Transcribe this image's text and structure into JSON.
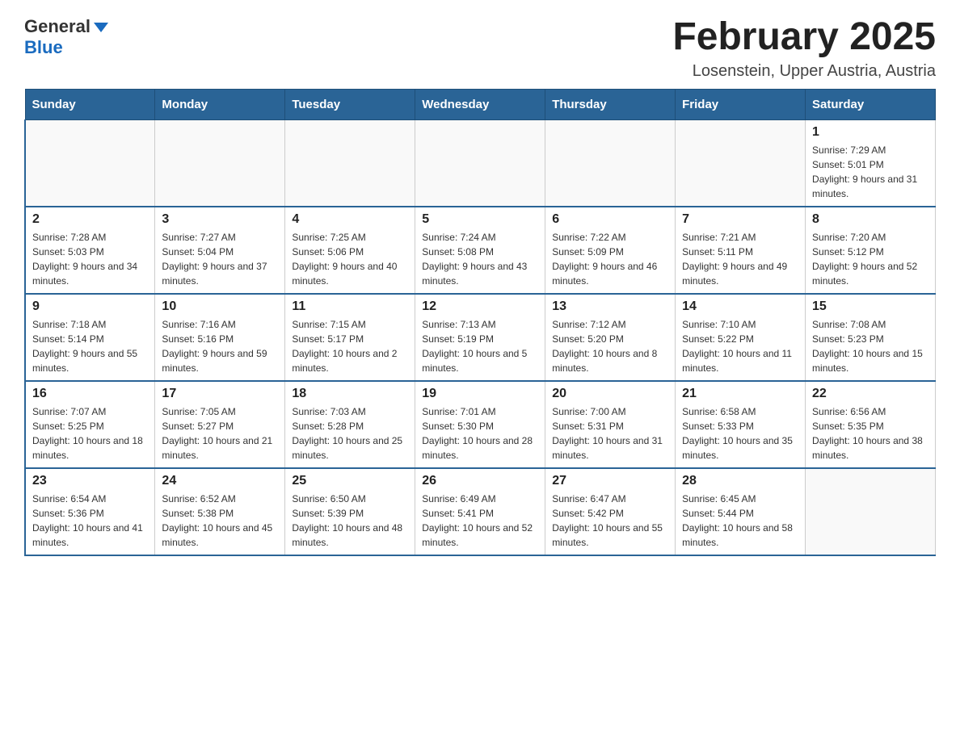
{
  "header": {
    "logo": {
      "text_general": "General",
      "text_blue": "Blue"
    },
    "title": "February 2025",
    "subtitle": "Losenstein, Upper Austria, Austria"
  },
  "days_of_week": [
    "Sunday",
    "Monday",
    "Tuesday",
    "Wednesday",
    "Thursday",
    "Friday",
    "Saturday"
  ],
  "weeks": [
    [
      {
        "day": "",
        "sunrise": "",
        "sunset": "",
        "daylight": ""
      },
      {
        "day": "",
        "sunrise": "",
        "sunset": "",
        "daylight": ""
      },
      {
        "day": "",
        "sunrise": "",
        "sunset": "",
        "daylight": ""
      },
      {
        "day": "",
        "sunrise": "",
        "sunset": "",
        "daylight": ""
      },
      {
        "day": "",
        "sunrise": "",
        "sunset": "",
        "daylight": ""
      },
      {
        "day": "",
        "sunrise": "",
        "sunset": "",
        "daylight": ""
      },
      {
        "day": "1",
        "sunrise": "Sunrise: 7:29 AM",
        "sunset": "Sunset: 5:01 PM",
        "daylight": "Daylight: 9 hours and 31 minutes."
      }
    ],
    [
      {
        "day": "2",
        "sunrise": "Sunrise: 7:28 AM",
        "sunset": "Sunset: 5:03 PM",
        "daylight": "Daylight: 9 hours and 34 minutes."
      },
      {
        "day": "3",
        "sunrise": "Sunrise: 7:27 AM",
        "sunset": "Sunset: 5:04 PM",
        "daylight": "Daylight: 9 hours and 37 minutes."
      },
      {
        "day": "4",
        "sunrise": "Sunrise: 7:25 AM",
        "sunset": "Sunset: 5:06 PM",
        "daylight": "Daylight: 9 hours and 40 minutes."
      },
      {
        "day": "5",
        "sunrise": "Sunrise: 7:24 AM",
        "sunset": "Sunset: 5:08 PM",
        "daylight": "Daylight: 9 hours and 43 minutes."
      },
      {
        "day": "6",
        "sunrise": "Sunrise: 7:22 AM",
        "sunset": "Sunset: 5:09 PM",
        "daylight": "Daylight: 9 hours and 46 minutes."
      },
      {
        "day": "7",
        "sunrise": "Sunrise: 7:21 AM",
        "sunset": "Sunset: 5:11 PM",
        "daylight": "Daylight: 9 hours and 49 minutes."
      },
      {
        "day": "8",
        "sunrise": "Sunrise: 7:20 AM",
        "sunset": "Sunset: 5:12 PM",
        "daylight": "Daylight: 9 hours and 52 minutes."
      }
    ],
    [
      {
        "day": "9",
        "sunrise": "Sunrise: 7:18 AM",
        "sunset": "Sunset: 5:14 PM",
        "daylight": "Daylight: 9 hours and 55 minutes."
      },
      {
        "day": "10",
        "sunrise": "Sunrise: 7:16 AM",
        "sunset": "Sunset: 5:16 PM",
        "daylight": "Daylight: 9 hours and 59 minutes."
      },
      {
        "day": "11",
        "sunrise": "Sunrise: 7:15 AM",
        "sunset": "Sunset: 5:17 PM",
        "daylight": "Daylight: 10 hours and 2 minutes."
      },
      {
        "day": "12",
        "sunrise": "Sunrise: 7:13 AM",
        "sunset": "Sunset: 5:19 PM",
        "daylight": "Daylight: 10 hours and 5 minutes."
      },
      {
        "day": "13",
        "sunrise": "Sunrise: 7:12 AM",
        "sunset": "Sunset: 5:20 PM",
        "daylight": "Daylight: 10 hours and 8 minutes."
      },
      {
        "day": "14",
        "sunrise": "Sunrise: 7:10 AM",
        "sunset": "Sunset: 5:22 PM",
        "daylight": "Daylight: 10 hours and 11 minutes."
      },
      {
        "day": "15",
        "sunrise": "Sunrise: 7:08 AM",
        "sunset": "Sunset: 5:23 PM",
        "daylight": "Daylight: 10 hours and 15 minutes."
      }
    ],
    [
      {
        "day": "16",
        "sunrise": "Sunrise: 7:07 AM",
        "sunset": "Sunset: 5:25 PM",
        "daylight": "Daylight: 10 hours and 18 minutes."
      },
      {
        "day": "17",
        "sunrise": "Sunrise: 7:05 AM",
        "sunset": "Sunset: 5:27 PM",
        "daylight": "Daylight: 10 hours and 21 minutes."
      },
      {
        "day": "18",
        "sunrise": "Sunrise: 7:03 AM",
        "sunset": "Sunset: 5:28 PM",
        "daylight": "Daylight: 10 hours and 25 minutes."
      },
      {
        "day": "19",
        "sunrise": "Sunrise: 7:01 AM",
        "sunset": "Sunset: 5:30 PM",
        "daylight": "Daylight: 10 hours and 28 minutes."
      },
      {
        "day": "20",
        "sunrise": "Sunrise: 7:00 AM",
        "sunset": "Sunset: 5:31 PM",
        "daylight": "Daylight: 10 hours and 31 minutes."
      },
      {
        "day": "21",
        "sunrise": "Sunrise: 6:58 AM",
        "sunset": "Sunset: 5:33 PM",
        "daylight": "Daylight: 10 hours and 35 minutes."
      },
      {
        "day": "22",
        "sunrise": "Sunrise: 6:56 AM",
        "sunset": "Sunset: 5:35 PM",
        "daylight": "Daylight: 10 hours and 38 minutes."
      }
    ],
    [
      {
        "day": "23",
        "sunrise": "Sunrise: 6:54 AM",
        "sunset": "Sunset: 5:36 PM",
        "daylight": "Daylight: 10 hours and 41 minutes."
      },
      {
        "day": "24",
        "sunrise": "Sunrise: 6:52 AM",
        "sunset": "Sunset: 5:38 PM",
        "daylight": "Daylight: 10 hours and 45 minutes."
      },
      {
        "day": "25",
        "sunrise": "Sunrise: 6:50 AM",
        "sunset": "Sunset: 5:39 PM",
        "daylight": "Daylight: 10 hours and 48 minutes."
      },
      {
        "day": "26",
        "sunrise": "Sunrise: 6:49 AM",
        "sunset": "Sunset: 5:41 PM",
        "daylight": "Daylight: 10 hours and 52 minutes."
      },
      {
        "day": "27",
        "sunrise": "Sunrise: 6:47 AM",
        "sunset": "Sunset: 5:42 PM",
        "daylight": "Daylight: 10 hours and 55 minutes."
      },
      {
        "day": "28",
        "sunrise": "Sunrise: 6:45 AM",
        "sunset": "Sunset: 5:44 PM",
        "daylight": "Daylight: 10 hours and 58 minutes."
      },
      {
        "day": "",
        "sunrise": "",
        "sunset": "",
        "daylight": ""
      }
    ]
  ]
}
